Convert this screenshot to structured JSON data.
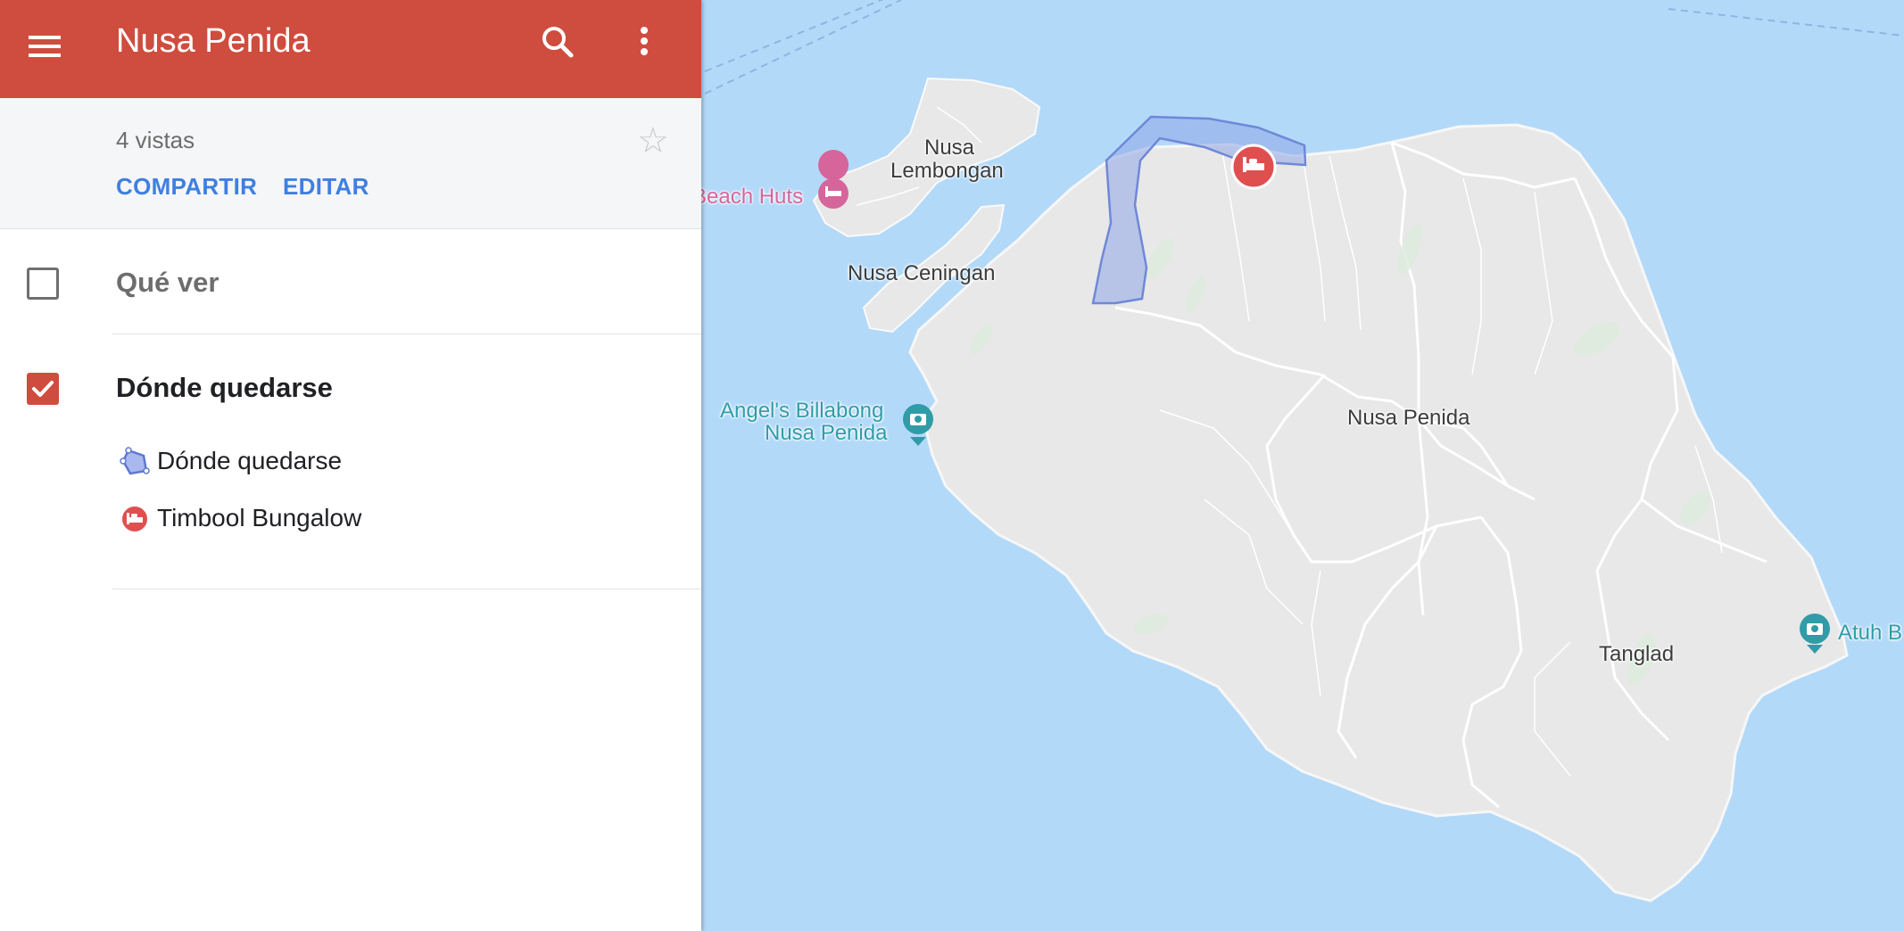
{
  "map": {
    "labels": {
      "nusa_lembongan_line1": "Nusa",
      "nusa_lembongan_line2": "Lembongan",
      "nusa_ceningan": "Nusa Ceningan",
      "nusa_penida": "Nusa Penida",
      "tanglad": "Tanglad",
      "beach_huts": "Beach Huts",
      "angels_billabong_line1": "Angel's Billabong",
      "angels_billabong_line2": "Nusa Penida",
      "atuh_beach": "Atuh B"
    },
    "colors": {
      "water": "#b3d9f9",
      "land": "#e8e8e8",
      "polygon": "#7d94e0",
      "hotel_marker": "#e04f4f"
    }
  },
  "panel": {
    "title": "Nusa Penida",
    "views": "4 vistas",
    "share_label": "COMPARTIR",
    "edit_label": "EDITAR",
    "star_glyph": "☆",
    "accent_color": "#cf4d3e",
    "layers": [
      {
        "name": "Qué ver",
        "checked": false
      },
      {
        "name": "Dónde quedarse",
        "checked": true,
        "items": [
          {
            "label": "Dónde quedarse",
            "icon": "polygon-icon"
          },
          {
            "label": "Timbool Bungalow",
            "icon": "hotel-icon"
          }
        ]
      }
    ]
  }
}
